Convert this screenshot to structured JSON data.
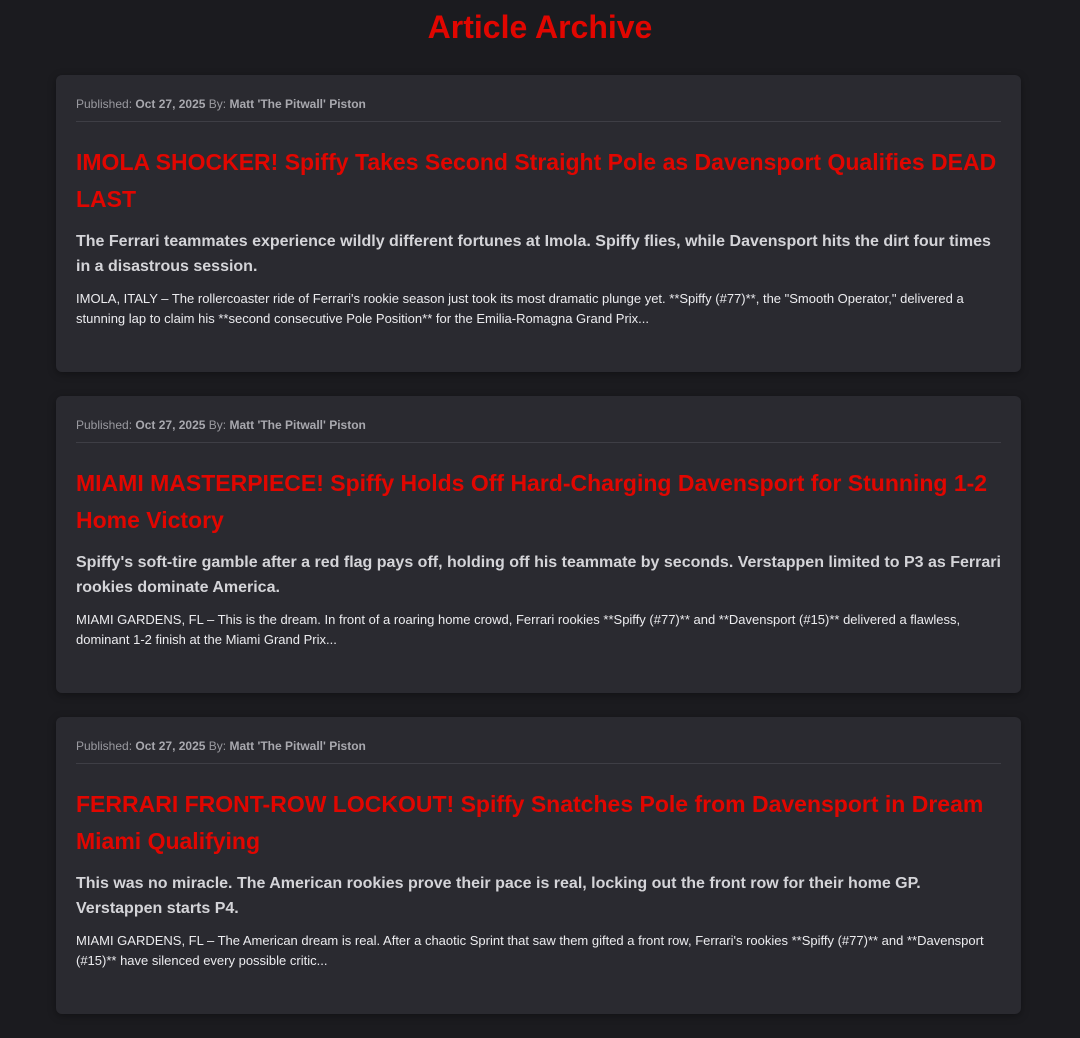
{
  "page": {
    "title": "Article Archive",
    "accent_color": "#e10600",
    "background_color": "#1b1b1f",
    "card_color": "#2a2a30"
  },
  "articles": [
    {
      "published_label": "Published:",
      "date": "Oct 27, 2025",
      "by_label": "By:",
      "author": "Matt 'The Pitwall' Piston",
      "headline": "IMOLA SHOCKER! Spiffy Takes Second Straight Pole as Davensport Qualifies DEAD LAST",
      "deck": "The Ferrari teammates experience wildly different fortunes at Imola. Spiffy flies, while Davensport hits the dirt four times in a disastrous session.",
      "excerpt": "IMOLA, ITALY – The rollercoaster ride of Ferrari's rookie season just took its most dramatic plunge yet. **Spiffy (#77)**, the \"Smooth Operator,\" delivered a stunning lap to claim his **second consecutive Pole Position** for the Emilia-Romagna Grand Prix..."
    },
    {
      "published_label": "Published:",
      "date": "Oct 27, 2025",
      "by_label": "By:",
      "author": "Matt 'The Pitwall' Piston",
      "headline": "MIAMI MASTERPIECE! Spiffy Holds Off Hard-Charging Davensport for Stunning 1-2 Home Victory",
      "deck": "Spiffy's soft-tire gamble after a red flag pays off, holding off his teammate by seconds. Verstappen limited to P3 as Ferrari rookies dominate America.",
      "excerpt": "MIAMI GARDENS, FL – This is the dream. In front of a roaring home crowd, Ferrari rookies **Spiffy (#77)** and **Davensport (#15)** delivered a flawless, dominant 1-2 finish at the Miami Grand Prix..."
    },
    {
      "published_label": "Published:",
      "date": "Oct 27, 2025",
      "by_label": "By:",
      "author": "Matt 'The Pitwall' Piston",
      "headline": "FERRARI FRONT-ROW LOCKOUT! Spiffy Snatches Pole from Davensport in Dream Miami Qualifying",
      "deck": "This was no miracle. The American rookies prove their pace is real, locking out the front row for their home GP. Verstappen starts P4.",
      "excerpt": "MIAMI GARDENS, FL – The American dream is real. After a chaotic Sprint that saw them gifted a front row, Ferrari's rookies **Spiffy (#77)** and **Davensport (#15)** have silenced every possible critic..."
    }
  ]
}
